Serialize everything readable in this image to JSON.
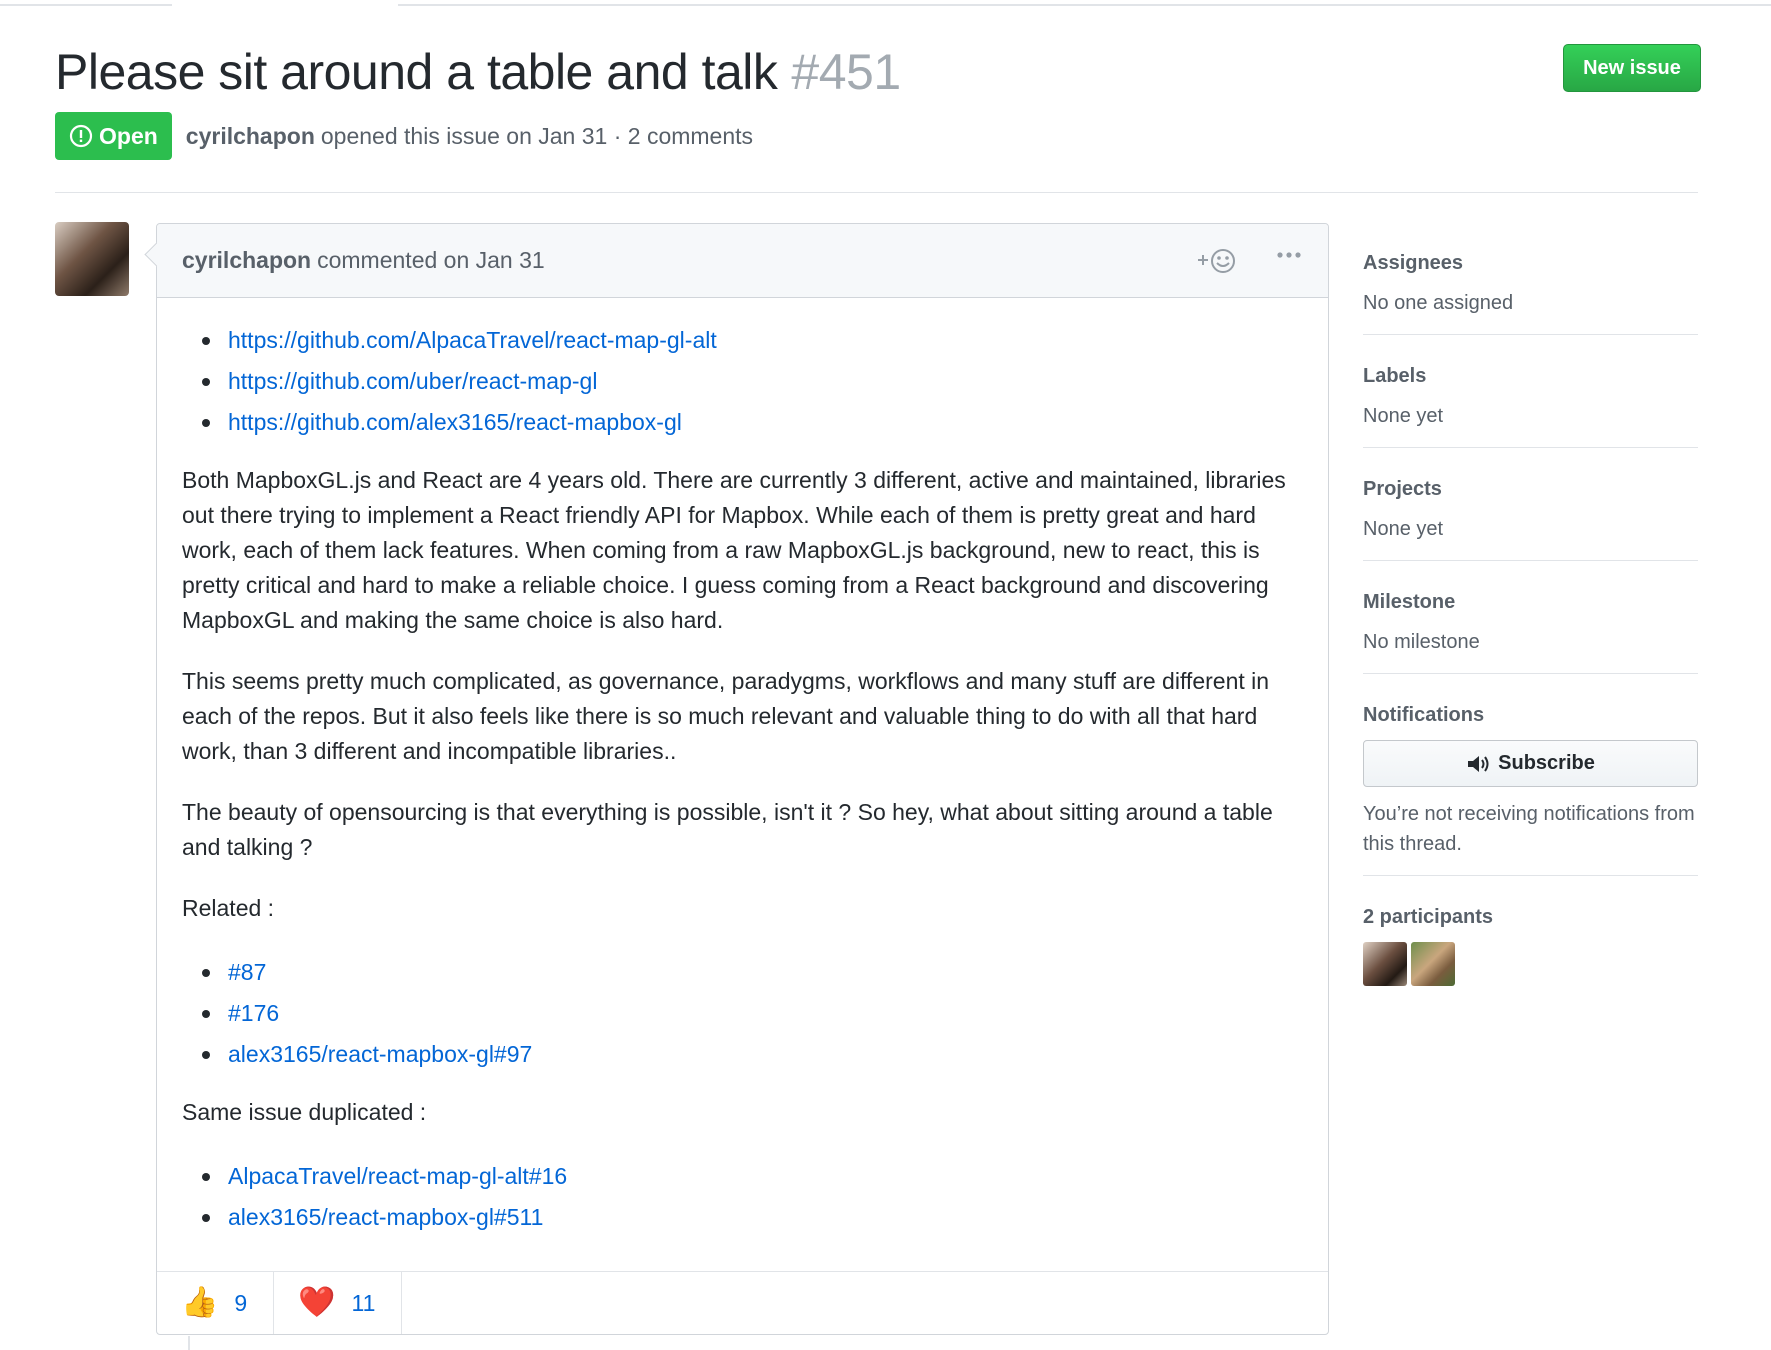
{
  "issue": {
    "title": "Please sit around a table and talk",
    "number": "#451",
    "state": "Open",
    "author": "cyrilchapon",
    "meta_text": "opened this issue on Jan 31 · 2 comments"
  },
  "header": {
    "new_issue_label": "New issue"
  },
  "comment": {
    "author": "cyrilchapon",
    "meta": "commented on Jan 31",
    "reaction_picker_icon": "smiley-plus-icon",
    "more_icon": "kebab-horizontal-icon",
    "links_top": [
      "https://github.com/AlpacaTravel/react-map-gl-alt",
      "https://github.com/uber/react-map-gl",
      "https://github.com/alex3165/react-mapbox-gl"
    ],
    "paragraphs": [
      "Both MapboxGL.js and React are 4 years old. There are currently 3 different, active and maintained, libraries out there trying to implement a React friendly API for Mapbox. While each of them is pretty great and hard work, each of them lack features. When coming from a raw MapboxGL.js background, new to react, this is pretty critical and hard to make a reliable choice. I guess coming from a React background and discovering MapboxGL and making the same choice is also hard.",
      "This seems pretty much complicated, as governance, paradygms, workflows and many stuff are different in each of the repos. But it also feels like there is so much relevant and valuable thing to do with all that hard work, than 3 different and incompatible libraries..",
      "The beauty of opensourcing is that everything is possible, isn't it ? So hey, what about sitting around a table and talking ?"
    ],
    "related_label": "Related :",
    "related_links": [
      "#87",
      "#176",
      "alex3165/react-mapbox-gl#97"
    ],
    "duplicated_label": "Same issue duplicated :",
    "duplicated_links": [
      "AlpacaTravel/react-map-gl-alt#16",
      "alex3165/react-mapbox-gl#511"
    ],
    "reactions": [
      {
        "emoji": "👍",
        "count": "9"
      },
      {
        "emoji": "❤️",
        "count": "11"
      }
    ]
  },
  "sidebar": {
    "assignees": {
      "heading": "Assignees",
      "value": "No one assigned"
    },
    "labels": {
      "heading": "Labels",
      "value": "None yet"
    },
    "projects": {
      "heading": "Projects",
      "value": "None yet"
    },
    "milestone": {
      "heading": "Milestone",
      "value": "No milestone"
    },
    "notifications": {
      "heading": "Notifications",
      "button_label": "Subscribe",
      "note": "You’re not receiving notifications from this thread."
    },
    "participants": {
      "heading": "2 participants"
    }
  },
  "colors": {
    "open_green": "#2cbe4e",
    "button_green": "#28a745",
    "link_blue": "#0366d6",
    "muted_text": "#586069"
  }
}
